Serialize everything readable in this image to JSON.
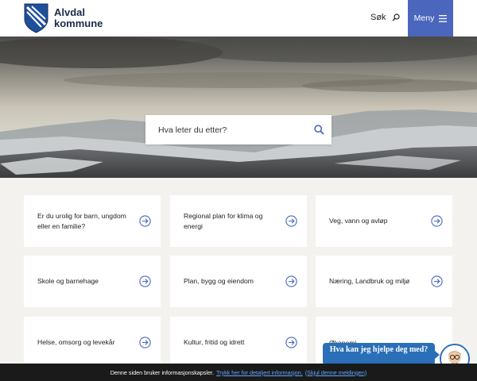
{
  "header": {
    "logo_line1": "Alvdal",
    "logo_line2": "kommune",
    "search_label": "Søk",
    "menu_label": "Meny"
  },
  "hero": {
    "search_placeholder": "Hva leter du etter?"
  },
  "cards": [
    {
      "label": "Er du urolig for barn, ungdom eller en familie?"
    },
    {
      "label": "Regional plan for klima og energi"
    },
    {
      "label": "Veg, vann og avløp"
    },
    {
      "label": "Skole og barnehage"
    },
    {
      "label": "Plan, bygg og eiendom"
    },
    {
      "label": "Næring, Landbruk og miljø"
    },
    {
      "label": "Helse, omsorg og levekår"
    },
    {
      "label": "Kultur, fritid og idrett"
    },
    {
      "label": "Økonomi"
    }
  ],
  "chat": {
    "text": "Hva kan jeg hjelpe deg med?"
  },
  "cookie": {
    "text": "Denne siden bruker informasjonskapsler.",
    "details_link": "Trykk her for detaljert informasjon.",
    "hide_link": "(Skjul denne meldingen)"
  },
  "colors": {
    "menu_bg": "#4a67bd",
    "chat_bg": "#2a6fb8",
    "cookie_bg": "#1a1a1a",
    "link": "#5ea6ff"
  }
}
